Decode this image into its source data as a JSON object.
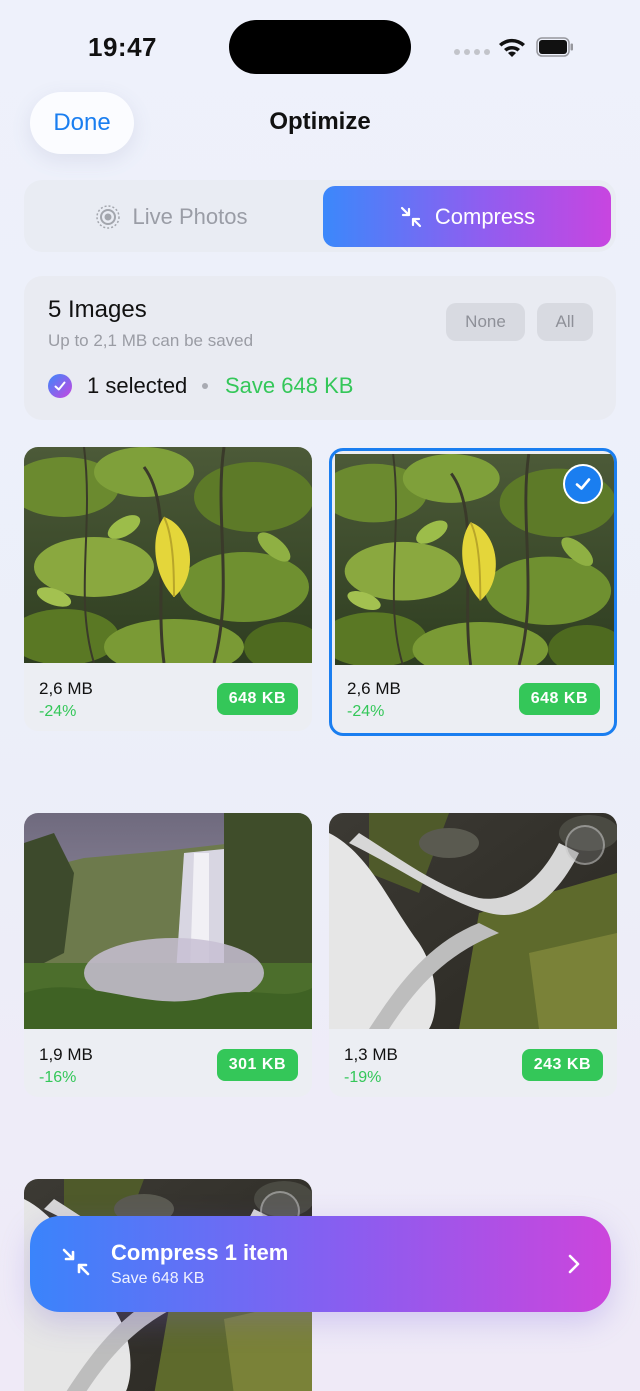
{
  "status": {
    "time": "19:47"
  },
  "header": {
    "done_label": "Done",
    "title": "Optimize"
  },
  "segments": {
    "live_label": "Live Photos",
    "compress_label": "Compress",
    "selected": "Compress"
  },
  "summary": {
    "title": "5 Images",
    "subtitle": "Up to 2,1 MB can be saved",
    "none_label": "None",
    "all_label": "All",
    "selected_text": "1 selected",
    "save_text": "Save 648 KB"
  },
  "items": [
    {
      "size": "2,6 MB",
      "percent": "-24%",
      "compressed": "648 KB",
      "selected": false,
      "image": "leaf-photo"
    },
    {
      "size": "2,6 MB",
      "percent": "-24%",
      "compressed": "648 KB",
      "selected": true,
      "image": "leaf-photo"
    },
    {
      "size": "1,9 MB",
      "percent": "-16%",
      "compressed": "301 KB",
      "selected": false,
      "image": "waterfall-valley-photo"
    },
    {
      "size": "1,3 MB",
      "percent": "-19%",
      "compressed": "243 KB",
      "selected": false,
      "image": "waterfall-rocks-photo"
    },
    {
      "size": "",
      "percent": "",
      "compressed": "",
      "selected": false,
      "image": "waterfall-rocks-photo"
    }
  ],
  "cta": {
    "title": "Compress 1 item",
    "subtitle": "Save 648 KB"
  },
  "colors": {
    "accent_blue": "#1a7ef0",
    "green": "#34c759",
    "gradient_start": "#3b88fb",
    "gradient_end": "#c845e0"
  }
}
